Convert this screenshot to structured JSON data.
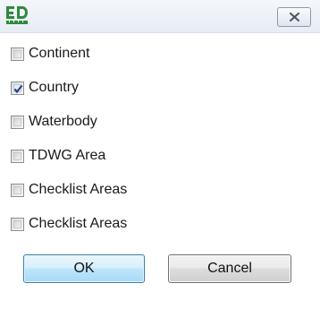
{
  "window": {
    "icon": "ed-app-icon",
    "close_icon": "close-icon",
    "close_glyph_color": "#4a5563"
  },
  "options": [
    {
      "label": "Continent",
      "checked": false
    },
    {
      "label": "Country",
      "checked": true
    },
    {
      "label": "Waterbody",
      "checked": false
    },
    {
      "label": "TDWG Area",
      "checked": false
    },
    {
      "label": "Checklist Areas",
      "checked": false
    },
    {
      "label": "Checklist Areas",
      "checked": false
    }
  ],
  "buttons": {
    "ok_label": "OK",
    "cancel_label": "Cancel"
  },
  "colors": {
    "check_mark": "#2a3f8f",
    "icon_green": "#2f8a3b",
    "ok_border": "#3c7fb1"
  }
}
